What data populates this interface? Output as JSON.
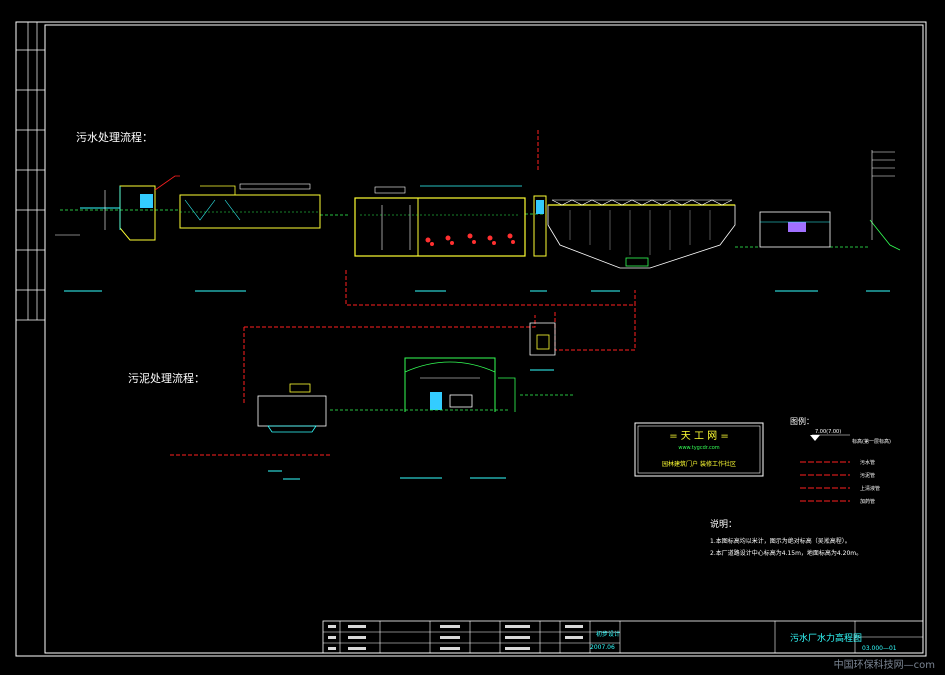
{
  "headings": {
    "sewage_flow": "污水处理流程：",
    "sludge_flow": "污泥处理流程："
  },
  "logo": {
    "brand": "= 天 工 网 =",
    "url": "www.tygcdr.com",
    "slogan": "园林建筑门户 装修工作社区"
  },
  "legend": {
    "title": "图例：",
    "level_value": "7.00(7.00)",
    "level_caption": "标高(第一层标高)",
    "items": [
      {
        "label": "污水管",
        "color": "#ff2020"
      },
      {
        "label": "污泥管",
        "color": "#ff2020"
      },
      {
        "label": "上清液管",
        "color": "#ff2020"
      },
      {
        "label": "加药管",
        "color": "#ff2020"
      }
    ]
  },
  "notes": {
    "title": "说明：",
    "lines": [
      "1.本图标高均以米计，图示为绝对标高（吴淞高程）。",
      "2.本厂道路设计中心标高为4.15m，地面标高为4.20m。"
    ]
  },
  "title_block": {
    "drawing_title": "污水厂水力高程图",
    "date": "2007.06",
    "drawing_no": "03.000—01",
    "stage": "初步设计"
  },
  "watermark": "中国环保科技网—com",
  "colors": {
    "structure": "#ffff33",
    "pipe": "#ff2020",
    "equipment": "#33ff55",
    "annotation": "#33ffff",
    "lines": "#ffffff"
  }
}
